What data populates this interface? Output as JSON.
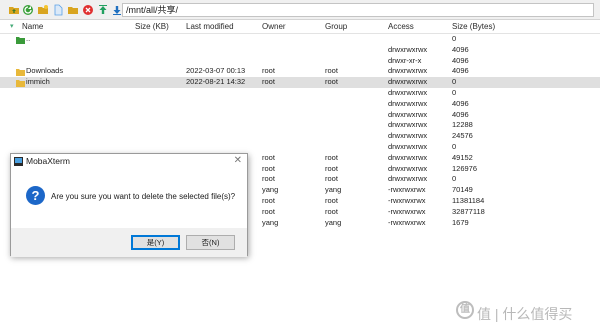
{
  "toolbar": {
    "buttons": [
      {
        "name": "parent-folder-icon",
        "color": "#d9a520"
      },
      {
        "name": "refresh-icon",
        "color": "#3aa03a"
      },
      {
        "name": "new-folder-icon",
        "color": "#d9a520"
      },
      {
        "name": "new-file-icon",
        "color": "#5aa0e6"
      },
      {
        "name": "open-folder-icon",
        "color": "#d9a520"
      },
      {
        "name": "delete-icon",
        "color": "#e03030"
      },
      {
        "name": "upload-icon",
        "color": "#22a060"
      },
      {
        "name": "download-icon",
        "color": "#2070c0"
      }
    ],
    "path": "/mnt/all/共享/"
  },
  "columns": {
    "name": "Name",
    "size_kb": "Size (KB)",
    "last_modified": "Last modified",
    "owner": "Owner",
    "group": "Group",
    "access": "Access",
    "size_bytes": "Size (Bytes)"
  },
  "rows": [
    {
      "name": "..",
      "icon": "parent-dir-icon",
      "modified": "",
      "owner": "",
      "group": "",
      "access": "",
      "size": "0",
      "selected": false
    },
    {
      "name": "",
      "icon": "",
      "modified": "",
      "owner": "",
      "group": "",
      "access": "drwxrwxrwx",
      "size": "4096",
      "selected": false
    },
    {
      "name": "",
      "icon": "",
      "modified": "",
      "owner": "",
      "group": "",
      "access": "drwxr-xr-x",
      "size": "4096",
      "selected": false
    },
    {
      "name": "Downloads",
      "icon": "folder-icon",
      "modified": "2022-03-07 00:13",
      "owner": "root",
      "group": "root",
      "access": "drwxrwxrwx",
      "size": "4096",
      "selected": false
    },
    {
      "name": "immich",
      "icon": "folder-icon",
      "modified": "2022-08-21 14:32",
      "owner": "root",
      "group": "root",
      "access": "drwxrwxrwx",
      "size": "0",
      "selected": true
    },
    {
      "name": "",
      "icon": "",
      "modified": "",
      "owner": "",
      "group": "",
      "access": "drwxrwxrwx",
      "size": "0",
      "selected": false
    },
    {
      "name": "",
      "icon": "",
      "modified": "",
      "owner": "",
      "group": "",
      "access": "drwxrwxrwx",
      "size": "4096",
      "selected": false
    },
    {
      "name": "",
      "icon": "",
      "modified": "",
      "owner": "",
      "group": "",
      "access": "drwxrwxrwx",
      "size": "4096",
      "selected": false
    },
    {
      "name": "",
      "icon": "",
      "modified": "",
      "owner": "",
      "group": "",
      "access": "drwxrwxrwx",
      "size": "12288",
      "selected": false
    },
    {
      "name": "",
      "icon": "",
      "modified": "",
      "owner": "",
      "group": "",
      "access": "drwxrwxrwx",
      "size": "24576",
      "selected": false
    },
    {
      "name": "",
      "icon": "",
      "modified": "",
      "owner": "",
      "group": "",
      "access": "drwxrwxrwx",
      "size": "0",
      "selected": false
    },
    {
      "name": "",
      "icon": "",
      "modified": "",
      "owner": "root",
      "group": "root",
      "access": "drwxrwxrwx",
      "size": "49152",
      "selected": false
    },
    {
      "name": "",
      "icon": "",
      "modified": "",
      "owner": "root",
      "group": "root",
      "access": "drwxrwxrwx",
      "size": "126976",
      "selected": false
    },
    {
      "name": "",
      "icon": "",
      "modified": "",
      "owner": "root",
      "group": "root",
      "access": "drwxrwxrwx",
      "size": "0",
      "selected": false
    },
    {
      "name": "",
      "icon": "",
      "modified": "",
      "owner": "yang",
      "group": "yang",
      "access": "-rwxrwxrwx",
      "size": "70149",
      "selected": false
    },
    {
      "name": "",
      "icon": "",
      "modified": "",
      "owner": "root",
      "group": "root",
      "access": "-rwxrwxrwx",
      "size": "11381184",
      "selected": false
    },
    {
      "name": "",
      "icon": "",
      "modified": "",
      "owner": "root",
      "group": "root",
      "access": "-rwxrwxrwx",
      "size": "32877118",
      "selected": false
    },
    {
      "name": "",
      "icon": "",
      "modified": "",
      "owner": "yang",
      "group": "yang",
      "access": "-rwxrwxrwx",
      "size": "1679",
      "selected": false
    }
  ],
  "dialog": {
    "title": "MobaXterm",
    "close": "✕",
    "message": "Are you sure you want to delete the selected file(s)?",
    "yes_label": "是(Y)",
    "no_label": "否(N)"
  },
  "watermark": {
    "text": "值 | 什么值得买",
    "badge": "值"
  },
  "colors": {
    "selection": "#dfdfdf",
    "toolbar_bg": "#f0f0f0",
    "folder": "#e8b83a",
    "dialog_accent": "#0078d7",
    "question_icon": "#1c67c8"
  }
}
